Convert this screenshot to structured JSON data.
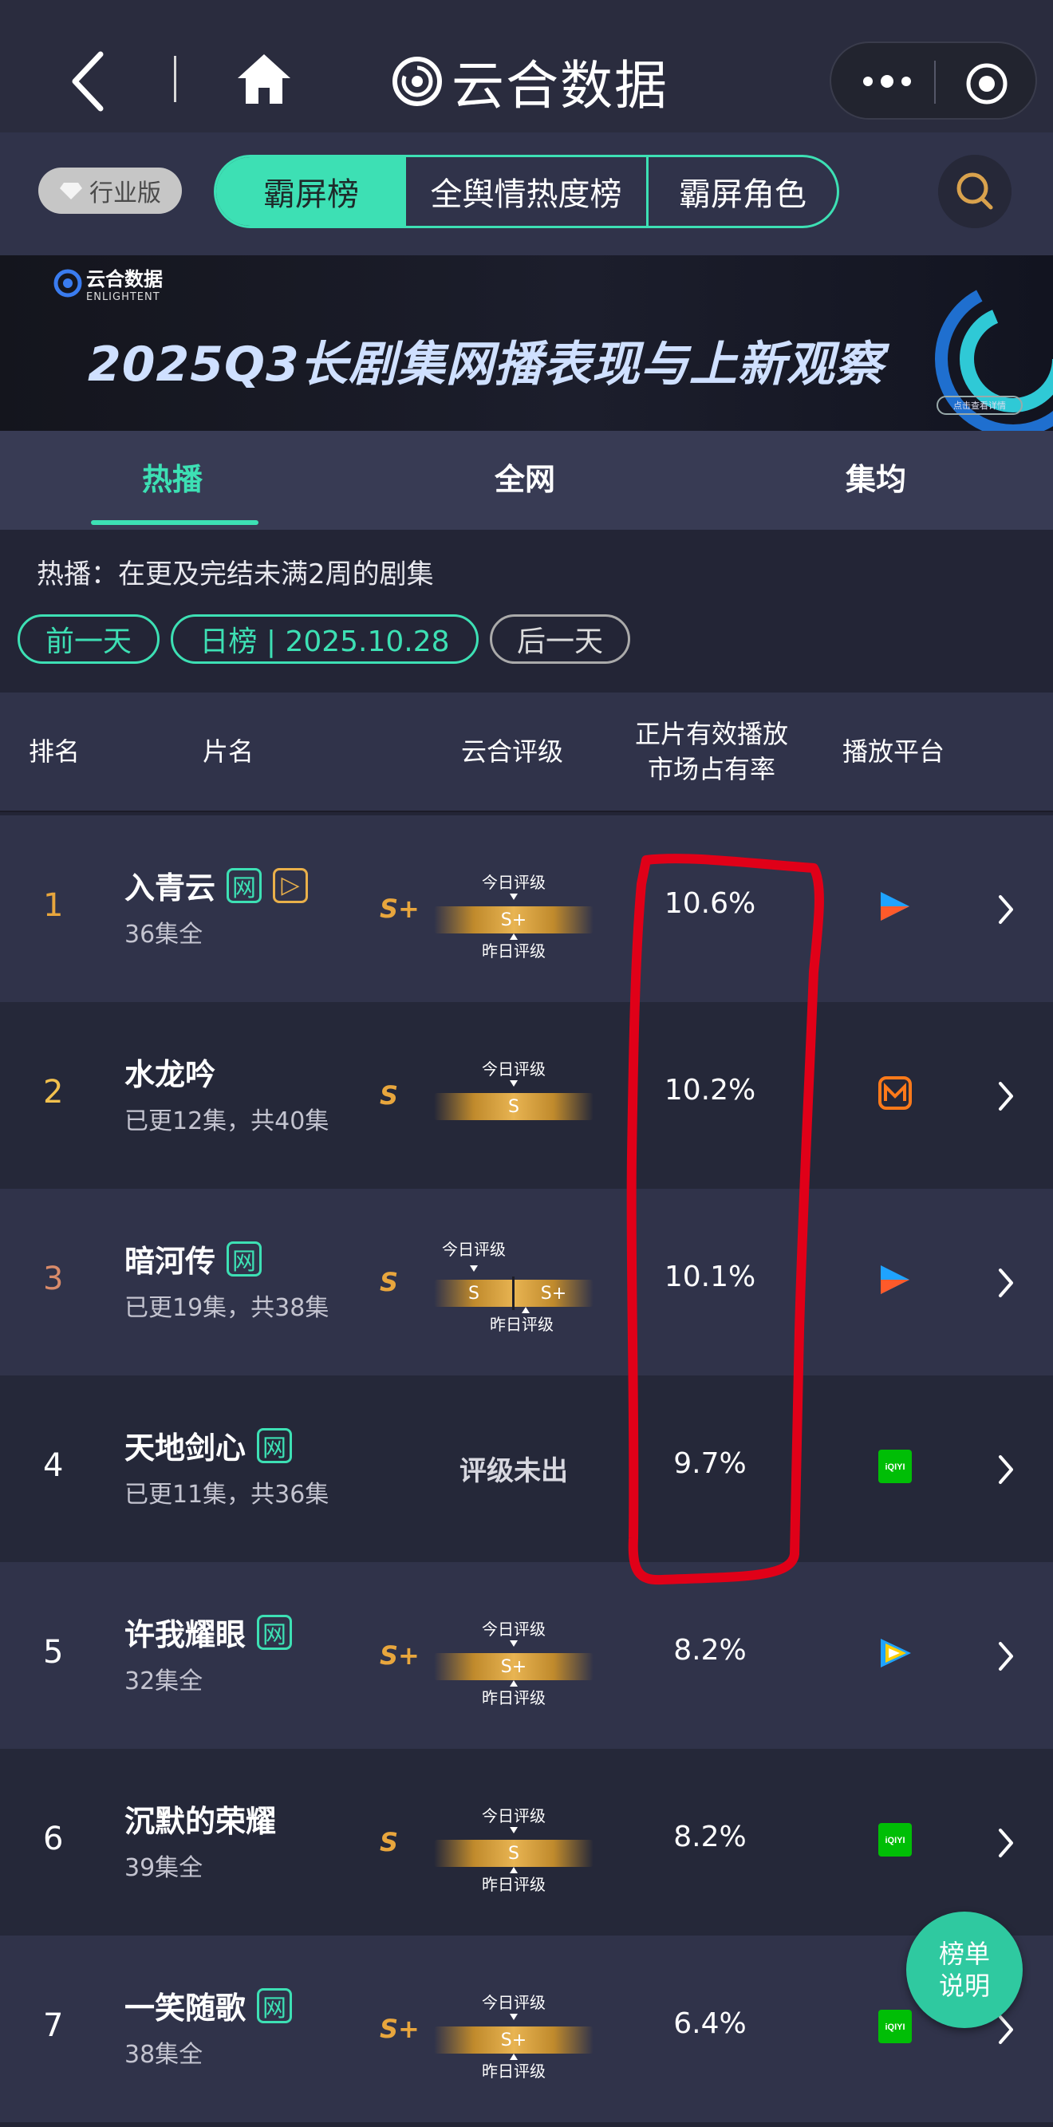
{
  "header": {
    "brand": "云合数据"
  },
  "tabs_row": {
    "edition": "行业版",
    "segments": [
      "霸屏榜",
      "全舆情热度榜",
      "霸屏角色"
    ]
  },
  "banner": {
    "logo_cn": "云合数据",
    "logo_en": "ENLIGHTENT",
    "title": "2025Q3长剧集网播表现与上新观察",
    "button": "点击查看详情"
  },
  "sub_tabs": [
    "热播",
    "全网",
    "集均"
  ],
  "description": "热播：在更及完结未满2周的剧集",
  "date_nav": {
    "prev": "前一天",
    "current": "日榜 | 2025.10.28",
    "next": "后一天"
  },
  "table": {
    "headers": {
      "rank": "排名",
      "title": "片名",
      "rating": "云合评级",
      "share_line1": "正片有效播放",
      "share_line2": "市场占有率",
      "platform": "播放平台"
    },
    "today_label": "今日评级",
    "yesterday_label": "昨日评级",
    "no_rating": "评级未出",
    "rows": [
      {
        "rank": "1",
        "title": "入青云",
        "tag1": "网",
        "tag2": "▷",
        "episodes": "36集全",
        "grade": "S+",
        "today": "S+",
        "yesterday": "",
        "share": "10.6%",
        "platform": "youku-icon"
      },
      {
        "rank": "2",
        "title": "水龙吟",
        "tag1": "",
        "tag2": "",
        "episodes": "已更12集，共40集",
        "grade": "S",
        "today": "S",
        "yesterday": "",
        "share": "10.2%",
        "platform": "mango-icon"
      },
      {
        "rank": "3",
        "title": "暗河传",
        "tag1": "网",
        "tag2": "",
        "episodes": "已更19集，共38集",
        "grade": "S",
        "today": "S",
        "yesterday": "S+",
        "share": "10.1%",
        "platform": "youku-icon"
      },
      {
        "rank": "4",
        "title": "天地剑心",
        "tag1": "网",
        "tag2": "",
        "episodes": "已更11集，共36集",
        "grade": "",
        "today": "",
        "yesterday": "",
        "share": "9.7%",
        "platform": "iqiyi-icon"
      },
      {
        "rank": "5",
        "title": "许我耀眼",
        "tag1": "网",
        "tag2": "",
        "episodes": "32集全",
        "grade": "S+",
        "today": "S+",
        "yesterday": "",
        "share": "8.2%",
        "platform": "tencent-video-icon"
      },
      {
        "rank": "6",
        "title": "沉默的荣耀",
        "tag1": "",
        "tag2": "",
        "episodes": "39集全",
        "grade": "S",
        "today": "S",
        "yesterday": "",
        "share": "8.2%",
        "platform": "iqiyi-icon"
      },
      {
        "rank": "7",
        "title": "一笑随歌",
        "tag1": "网",
        "tag2": "",
        "episodes": "38集全",
        "grade": "S+",
        "today": "S+",
        "yesterday": "",
        "share": "6.4%",
        "platform": "iqiyi-icon"
      }
    ]
  },
  "iqiyi_text": "iQIYI",
  "float_button": [
    "榜单",
    "说明"
  ],
  "colors": {
    "accent": "#3de0b4",
    "gold": "#e8a63d",
    "annotation_red": "#e00018",
    "rank1": "#e8a63d",
    "rank2": "#f2c14e",
    "rank3": "#d98b6a"
  }
}
